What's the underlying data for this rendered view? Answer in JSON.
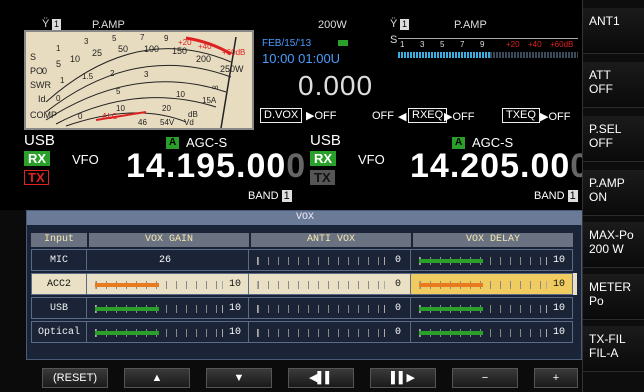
{
  "left": {
    "pamp": "P.AMP",
    "ant_num": "1",
    "vox_box": "D.VOX",
    "vox_state": "OFF",
    "mode": "USB",
    "rx": "RX",
    "tx": "TX",
    "vfo": "VFO",
    "agc_a": "A",
    "agc": "AGC-S",
    "freq_main": "14.195.00",
    "freq_last": "0",
    "band": "BAND",
    "band_num": "1"
  },
  "center": {
    "power": "200W",
    "date": "FEB/15/'13",
    "time": "10:00 01:00U",
    "offset": "0.000",
    "off1": "OFF",
    "rxeq": "RXEQ",
    "off2": "OFF",
    "txeq": "TXEQ",
    "off3": "OFF"
  },
  "right": {
    "pamp": "P.AMP",
    "ant_num": "1",
    "s_label": "S",
    "s_ticks": [
      "1",
      "3",
      "5",
      "7",
      "9",
      "+20",
      "+40",
      "+60dB"
    ],
    "mode": "USB",
    "rx": "RX",
    "tx": "TX",
    "vfo": "VFO",
    "agc_a": "A",
    "agc": "AGC-S",
    "freq_main": "14.205.00",
    "freq_last": "0",
    "band": "BAND",
    "band_num": "1"
  },
  "meter": {
    "labels": [
      "S",
      "PO",
      "SWR",
      "Id",
      "COMP",
      "ALC"
    ],
    "scale_top": [
      "1",
      "3",
      "5",
      "7",
      "9",
      "+20",
      "+40",
      "+60dB"
    ],
    "scale_po": [
      "0",
      "5",
      "10",
      "25",
      "50",
      "100",
      "150",
      "200",
      "250W"
    ],
    "scale_swr": [
      "1",
      "1.5",
      "2",
      "3",
      "∞"
    ],
    "scale_id": [
      "0",
      "5",
      "10",
      "15A"
    ],
    "scale_comp": [
      "0",
      "10",
      "20",
      "dB"
    ],
    "scale_vd": [
      "46",
      "54V",
      "Vd"
    ]
  },
  "vox": {
    "title": "VOX",
    "headers": [
      "Input",
      "VOX GAIN",
      "ANTI VOX",
      "VOX DELAY"
    ],
    "rows": [
      {
        "name": "MIC",
        "gain": "26",
        "gain_is_text": true,
        "anti": "0",
        "delay": "10",
        "gain_level": 0,
        "anti_level": 0,
        "delay_level": 0.5
      },
      {
        "name": "ACC2",
        "gain": "10",
        "gain_is_text": false,
        "anti": "0",
        "delay": "10",
        "gain_level": 0.5,
        "anti_level": 0,
        "delay_level": 0.5,
        "highlight": true
      },
      {
        "name": "USB",
        "gain": "10",
        "gain_is_text": false,
        "anti": "0",
        "delay": "10",
        "gain_level": 0.5,
        "anti_level": 0,
        "delay_level": 0.5
      },
      {
        "name": "Optical",
        "gain": "10",
        "gain_is_text": false,
        "anti": "0",
        "delay": "10",
        "gain_level": 0.5,
        "anti_level": 0,
        "delay_level": 0.5
      }
    ]
  },
  "softkeys": [
    {
      "line1": "ANT1",
      "line2": ""
    },
    {
      "line1": "ATT",
      "line2": "OFF"
    },
    {
      "line1": "P.SEL",
      "line2": "OFF"
    },
    {
      "line1": "P.AMP",
      "line2": "ON"
    },
    {
      "line1": "MAX-Po",
      "line2": "200 W"
    },
    {
      "line1": "METER",
      "line2": "Po"
    },
    {
      "line1": "TX-FIL",
      "line2": "FIL-A"
    }
  ],
  "bottom": [
    "(RESET)",
    "▲",
    "▼",
    "◀▌▌",
    "▌▌▶",
    "−",
    "+"
  ],
  "colors": {
    "green": "#2aa02a",
    "orange": "#e87a20",
    "red": "#d22",
    "panel": "#1a2436",
    "highlight": "#e9e0c5"
  }
}
